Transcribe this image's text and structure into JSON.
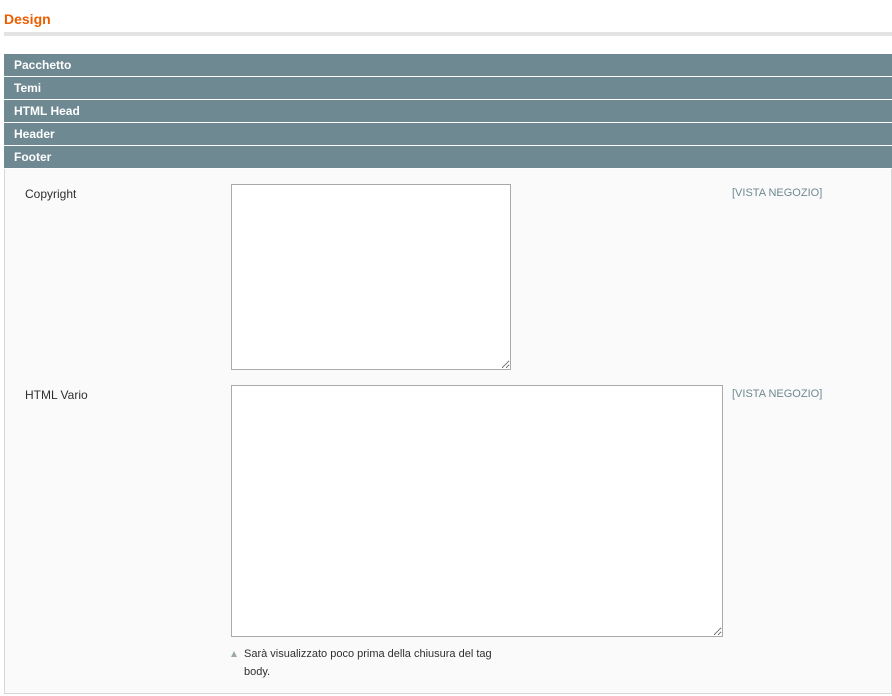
{
  "page": {
    "title": "Design"
  },
  "sections": [
    {
      "label": "Pacchetto"
    },
    {
      "label": "Temi"
    },
    {
      "label": "HTML Head"
    },
    {
      "label": "Header"
    },
    {
      "label": "Footer"
    }
  ],
  "footer": {
    "fields": [
      {
        "label": "Copyright",
        "value": "",
        "scope": "[VISTA NEGOZIO]"
      },
      {
        "label": "HTML Vario",
        "value": "",
        "scope": "[VISTA NEGOZIO]",
        "note": "Sarà visualizzato poco prima della chiusura del tag body."
      }
    ]
  },
  "colors": {
    "accent": "#eb5e00",
    "section_header_bg": "#6f8992",
    "scope_text": "#6f8992",
    "panel_bg": "#fafafa"
  },
  "icons": {
    "note": "triangle-up-icon"
  }
}
